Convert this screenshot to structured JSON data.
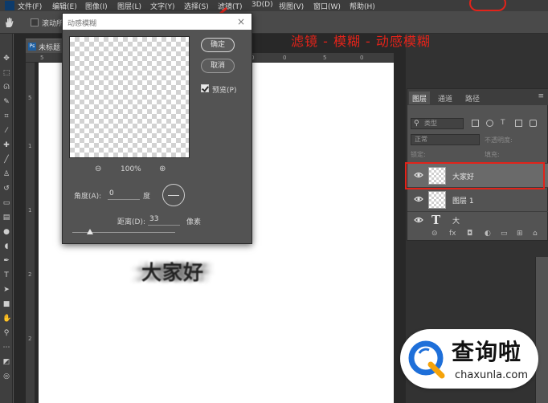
{
  "menu_bar": {
    "items": [
      "文件(F)",
      "编辑(E)",
      "图像(I)",
      "图层(L)",
      "文字(Y)",
      "选择(S)",
      "滤镜(T)",
      "3D(D)",
      "视图(V)",
      "窗口(W)",
      "帮助(H)"
    ]
  },
  "options_bar": {
    "checkbox_label": "滚动所"
  },
  "document": {
    "tab_title": "未标题"
  },
  "canvas": {
    "text": "大家好"
  },
  "annotation": {
    "text": "滤镜 - 模糊 - 动感模糊",
    "color": "#e2231a"
  },
  "dialog": {
    "title": "动感模糊",
    "ok_label": "确定",
    "cancel_label": "取消",
    "preview_label": "预览(P)",
    "preview_checked": true,
    "zoom_value": "100%",
    "angle_label": "角度(A):",
    "angle_value": "0",
    "angle_unit": "度",
    "distance_label": "距离(D):",
    "distance_value": "33",
    "distance_unit": "像素"
  },
  "layers_panel": {
    "tabs": [
      "图层",
      "通道",
      "路径"
    ],
    "active_tab": "图层",
    "filter_placeholder": "类型",
    "blend_mode": "正常",
    "opacity_label": "不透明度:",
    "lock_label": "锁定:",
    "fill_label": "填充:",
    "layers": [
      {
        "name": "大家好",
        "type": "smart-object",
        "selected": true,
        "visible": true
      },
      {
        "name": "图层 1",
        "type": "raster",
        "selected": false,
        "visible": true
      },
      {
        "name": "大",
        "type": "text",
        "selected": false,
        "visible": true
      }
    ]
  },
  "watermark": {
    "text_cn": "查询啦",
    "text_en": "chaxunla.com"
  },
  "colors": {
    "accent_red": "#e2231a",
    "ui_dark": "#535353",
    "logo_blue": "#1e6fd9"
  }
}
